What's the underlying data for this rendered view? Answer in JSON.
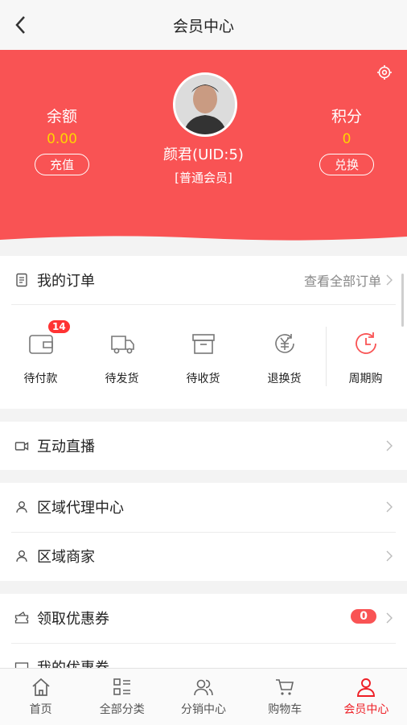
{
  "nav": {
    "title": "会员中心"
  },
  "profile": {
    "balance_label": "余额",
    "balance_value": "0.00",
    "recharge_button": "充值",
    "points_label": "积分",
    "points_value": "0",
    "redeem_button": "兑换",
    "user_name": "颜君(UID:5)",
    "member_level": "[普通会员]"
  },
  "orders": {
    "title": "我的订单",
    "view_all": "查看全部订单",
    "items": [
      {
        "label": "待付款",
        "badge": "14"
      },
      {
        "label": "待发货"
      },
      {
        "label": "待收货"
      },
      {
        "label": "退换货"
      },
      {
        "label": "周期购"
      }
    ]
  },
  "menu": {
    "live": "互动直播",
    "agent": "区域代理中心",
    "merchant": "区域商家",
    "coupon": "领取优惠券",
    "coupon_badge": "0",
    "my_coupon": "我的优惠券"
  },
  "tabs": [
    {
      "label": "首页",
      "icon": "home-icon"
    },
    {
      "label": "全部分类",
      "icon": "category-icon"
    },
    {
      "label": "分销中心",
      "icon": "users-icon"
    },
    {
      "label": "购物车",
      "icon": "cart-icon"
    },
    {
      "label": "会员中心",
      "icon": "person-icon",
      "active": true
    }
  ],
  "colors": {
    "brand": "#f95354",
    "yellow": "#ffd400",
    "active_tab": "#ee1e25"
  }
}
